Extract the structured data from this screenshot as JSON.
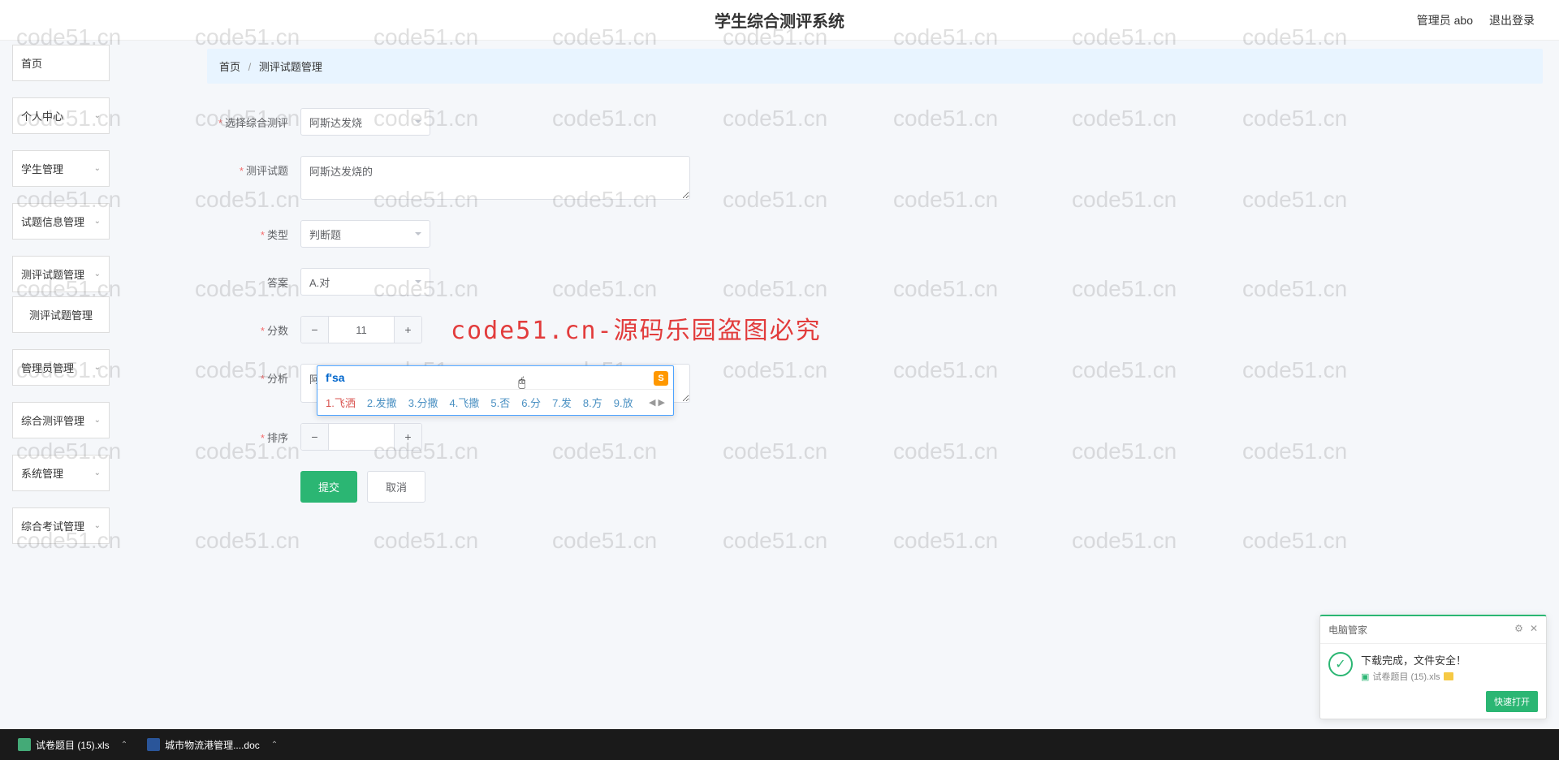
{
  "header": {
    "title": "学生综合测评系统",
    "user": "管理员 abo",
    "logout": "退出登录"
  },
  "sidebar": {
    "items": [
      {
        "label": "首页",
        "expandable": false
      },
      {
        "label": "个人中心",
        "expandable": true
      },
      {
        "label": "学生管理",
        "expandable": true
      },
      {
        "label": "试题信息管理",
        "expandable": true
      },
      {
        "label": "测评试题管理",
        "expandable": true,
        "sub": "测评试题管理"
      },
      {
        "label": "管理员管理",
        "expandable": true
      },
      {
        "label": "综合测评管理",
        "expandable": true
      },
      {
        "label": "系统管理",
        "expandable": true
      },
      {
        "label": "综合考试管理",
        "expandable": true
      }
    ]
  },
  "breadcrumb": {
    "home": "首页",
    "current": "测评试题管理"
  },
  "form": {
    "select_eval": {
      "label": "选择综合测评",
      "value": "阿斯达发烧"
    },
    "question": {
      "label": "测评试题",
      "value": "阿斯达发烧的"
    },
    "type": {
      "label": "类型",
      "value": "判断题"
    },
    "answer": {
      "label": "答案",
      "value": "A.对"
    },
    "score": {
      "label": "分数",
      "value": "11"
    },
    "analysis": {
      "label": "分析",
      "value": "阿斯达"
    },
    "sort": {
      "label": "排序",
      "value": ""
    },
    "submit": "提交",
    "cancel": "取消"
  },
  "ime": {
    "input": "f'sa",
    "candidates": [
      "1.飞洒",
      "2.发撒",
      "3.分撒",
      "4.飞撒",
      "5.否",
      "6.分",
      "7.发",
      "8.方",
      "9.放"
    ]
  },
  "watermark": "code51.cn",
  "overlay": "code51.cn-源码乐园盗图必究",
  "taskbar": {
    "items": [
      {
        "label": "试卷题目 (15).xls"
      },
      {
        "label": "城市物流港管理....doc"
      }
    ]
  },
  "toast": {
    "title": "电脑管家",
    "message": "下载完成，文件安全！",
    "file": "试卷题目 (15).xls",
    "button": "快速打开"
  }
}
